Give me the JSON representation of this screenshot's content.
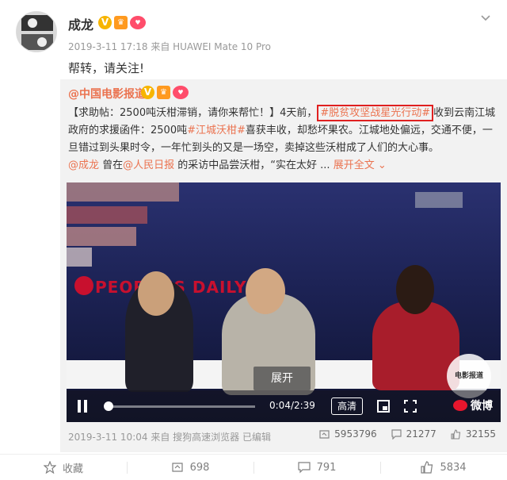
{
  "post": {
    "author": "成龙",
    "meta": "2019-3-11 17:18 来自 HUAWEI Mate 10 Pro",
    "text": "帮转，请关注!"
  },
  "repost": {
    "author": "@中国电影报道",
    "text_parts": {
      "t1": "【求助帖：2500吨沃柑滞销，请你来帮忙！】4天前，",
      "tag1": "#脱贫攻坚战星光行动#",
      "t2": "收到云南江城政府的求援函件：2500吨",
      "tag2": "#江城沃柑#",
      "t3": "喜获丰收，却愁坏果农。江城地处偏远，交通不便，一旦错过到头果时令，一年忙到头的又是一场空，卖掉这些沃柑成了人们的大心事。",
      "mention1": "@成龙",
      "t4": " 曾在",
      "mention2": "@人民日报",
      "t5": " 的采访中品尝沃柑，“实在太好 ... ",
      "expand": "展开全文"
    },
    "video": {
      "overlay_label": "展开",
      "channel_text": "PEOPLE'S DAILY",
      "corner_logo": "电影报道",
      "time": "0:04/2:39",
      "progress": 0.025,
      "quality": "高清",
      "brand": "微博"
    },
    "meta": "2019-3-11 10:04 来自 搜狗高速浏览器  已编辑",
    "stats": {
      "reposts": "5953796",
      "comments": "21277",
      "likes": "32155"
    }
  },
  "actions": {
    "favorite": "收藏",
    "repost_count": "698",
    "comment_count": "791",
    "like_count": "5834"
  },
  "colors": {
    "accent": "#eb7350",
    "highlight_box": "#e02020",
    "weibo_red": "#e6162d"
  }
}
